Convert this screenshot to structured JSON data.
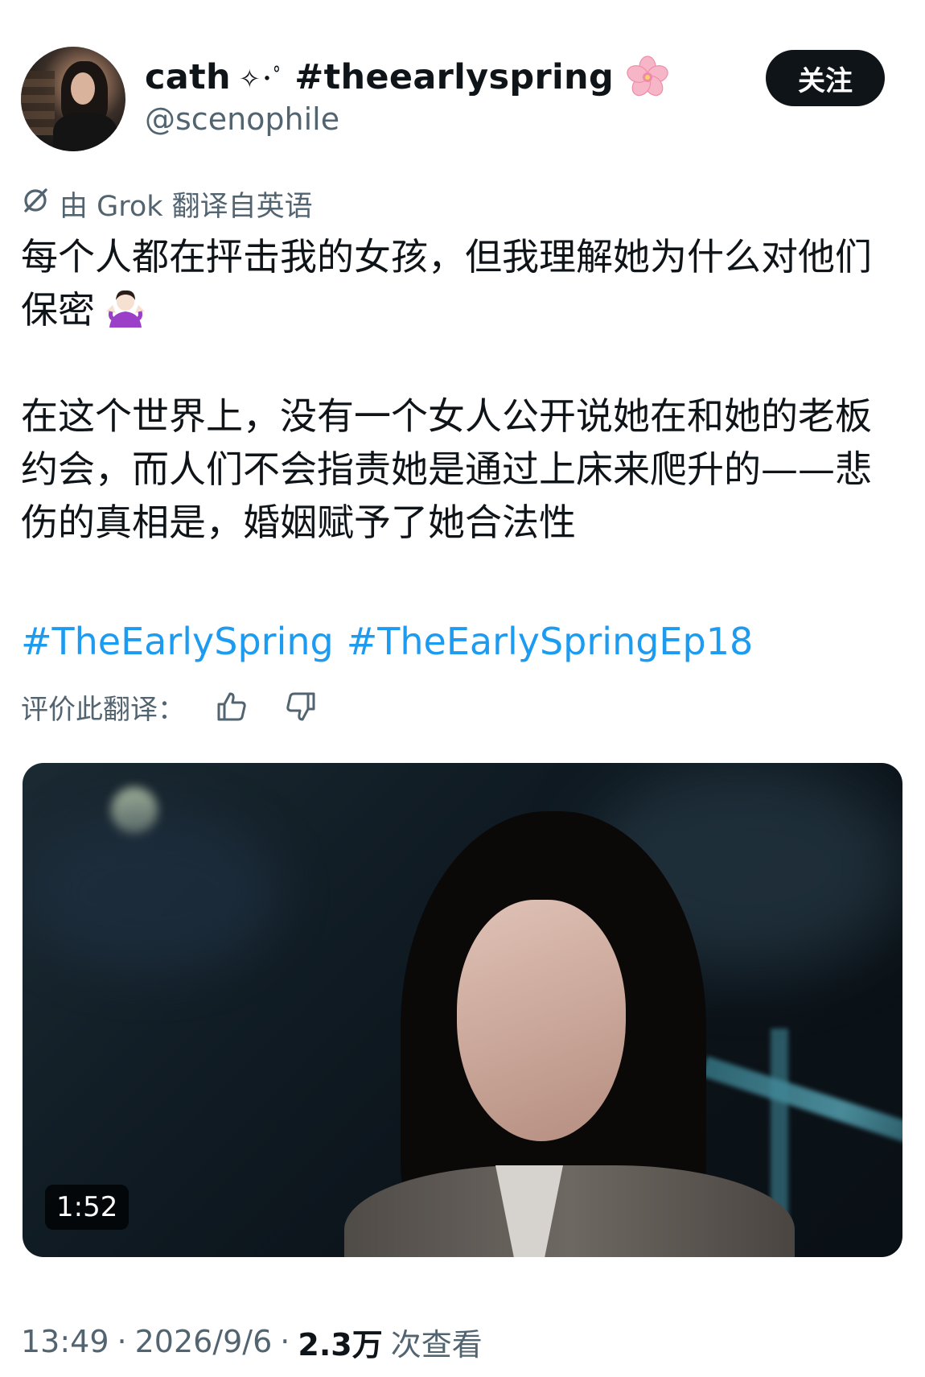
{
  "author": {
    "display_name": "cath",
    "name_decoration": "✧･ﾟ",
    "name_hashtag": "#theearlyspring",
    "handle": "@scenophile",
    "follow_label": "关注"
  },
  "translation": {
    "note": "由 Grok 翻译自英语",
    "rate_label": "评价此翻译："
  },
  "tweet": {
    "paragraph_1": "每个人都在抨击我的女孩，但我理解她为什么对他们保密",
    "paragraph_2": "在这个世界上，没有一个女人公开说她在和她的老板约会，而人们不会指责她是通过上床来爬升的——悲伤的真相是，婚姻赋予了她合法性",
    "hashtags": [
      "#TheEarlySpring",
      "#TheEarlySpringEp18"
    ]
  },
  "video": {
    "duration": "1:52"
  },
  "meta": {
    "time": "13:49",
    "separator": "·",
    "date": "2026/9/6",
    "views_count": "2.3万",
    "views_label": "次查看"
  },
  "icons": {
    "flower": "cherry-blossom-icon",
    "shrug": "shrug-emoji-icon",
    "translate": "grok-icon",
    "thumbs_up": "thumbs-up-icon",
    "thumbs_down": "thumbs-down-icon"
  },
  "colors": {
    "link": "#1d9bf0",
    "secondary_text": "#536471",
    "follow_button_bg": "#0f1419"
  }
}
